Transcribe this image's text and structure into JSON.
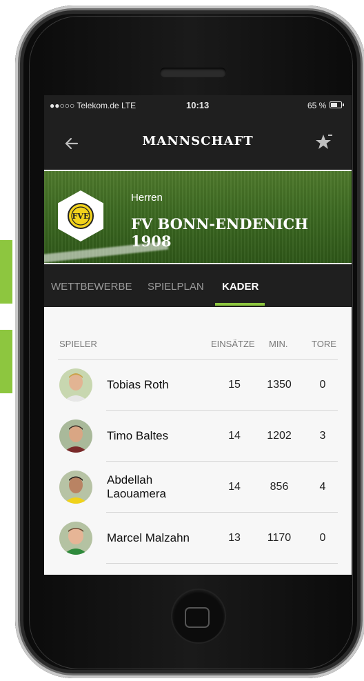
{
  "status_bar": {
    "carrier": "●●○○○ Telekom.de  LTE",
    "time": "10:13",
    "battery": "65 %"
  },
  "header": {
    "title": "MANNSCHAFT"
  },
  "team": {
    "category": "Herren",
    "name": "FV BONN-ENDENICH 1908",
    "crest_text": "FVE"
  },
  "tabs": [
    {
      "label": "WETTBEWERBE",
      "active": false
    },
    {
      "label": "SPIELPLAN",
      "active": false
    },
    {
      "label": "KADER",
      "active": true
    }
  ],
  "table": {
    "columns": [
      "SPIELER",
      "EINSÄTZE",
      "MIN.",
      "TORE"
    ],
    "rows": [
      {
        "name": "Tobias Roth",
        "apps": "15",
        "min": "1350",
        "goals": "0"
      },
      {
        "name": "Timo Baltes",
        "apps": "14",
        "min": "1202",
        "goals": "3"
      },
      {
        "name": "Abdellah Laouamera",
        "apps": "14",
        "min": "856",
        "goals": "4"
      },
      {
        "name": "Marcel Malzahn",
        "apps": "13",
        "min": "1170",
        "goals": "0"
      }
    ]
  },
  "colors": {
    "accent": "#8dc63f",
    "dark": "#1f1f1f",
    "crest_yellow": "#f2d21b"
  },
  "icons": {
    "back": "arrow-left-icon",
    "favorite": "star-icon",
    "home": "home-button-icon"
  }
}
